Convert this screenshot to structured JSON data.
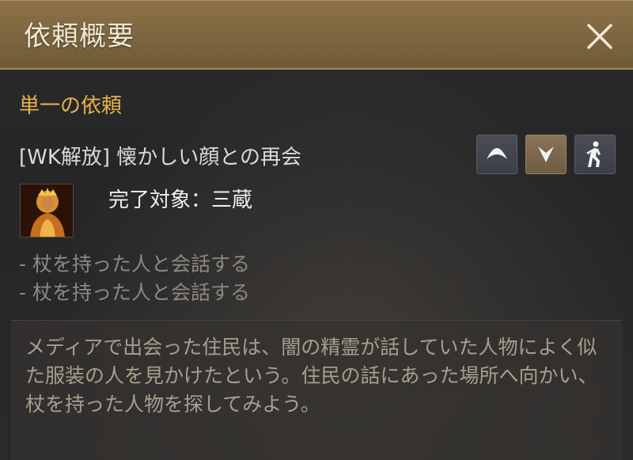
{
  "window": {
    "title": "依頼概要",
    "close_icon": "close-icon"
  },
  "quest": {
    "category": "単一の依頼",
    "name": "[WK解放] 懐かしい顔との再会",
    "target_label": "完了対象：三蔵",
    "objectives": [
      "- 杖を持った人と会話する",
      "- 杖を持った人と会話する"
    ],
    "description": "メディアで出会った住民は、闇の精霊が話していた人物によく似た服装の人を見かけたという。住民の話にあった場所へ向かい、杖を持った人物を探してみよう。"
  },
  "buttons": {
    "up_icon": "chevron-up-icon",
    "down_icon": "chevron-down-icon",
    "walk_icon": "auto-walk-icon"
  },
  "colors": {
    "title_bar": "#7d6640",
    "category_text": "#e5b345",
    "objective_text": "#8c8984",
    "description_text": "#a89e8e"
  }
}
